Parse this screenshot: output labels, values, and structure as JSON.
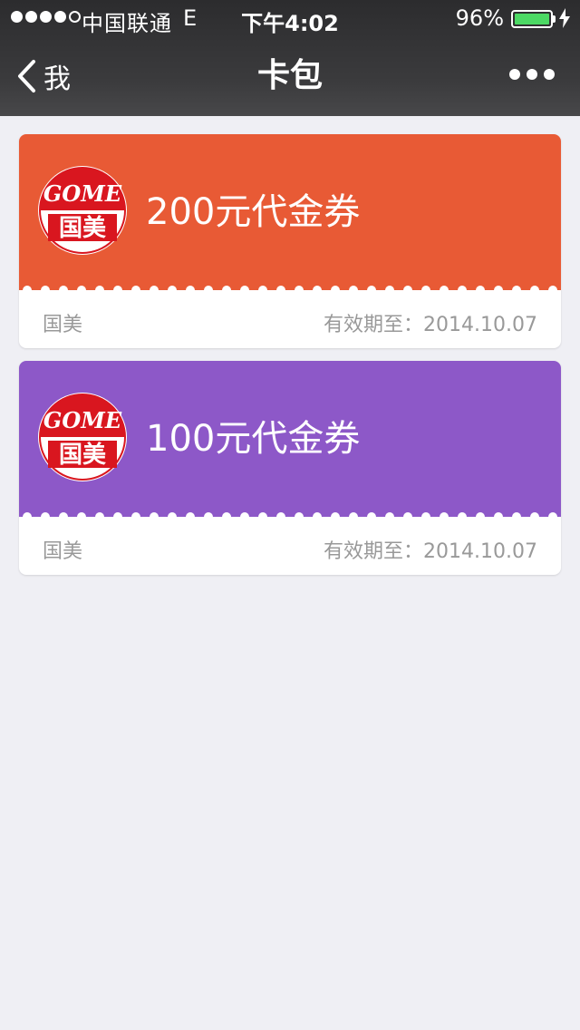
{
  "status": {
    "carrier": "中国联通",
    "network": "E",
    "time": "下午4:02",
    "battery": "96%"
  },
  "nav": {
    "back_label": "我",
    "title": "卡包"
  },
  "cards": [
    {
      "title": "200元代金券",
      "merchant": "国美",
      "expiry": "有效期至：2014.10.07",
      "color": "#e85a35",
      "logo_text_top": "GOME",
      "logo_text_bottom": "国美"
    },
    {
      "title": "100元代金券",
      "merchant": "国美",
      "expiry": "有效期至：2014.10.07",
      "color": "#8d58c8",
      "logo_text_top": "GOME",
      "logo_text_bottom": "国美"
    }
  ],
  "colors": {
    "background": "#efeff4",
    "logo_red": "#d9161f",
    "battery_green": "#4cd964"
  }
}
